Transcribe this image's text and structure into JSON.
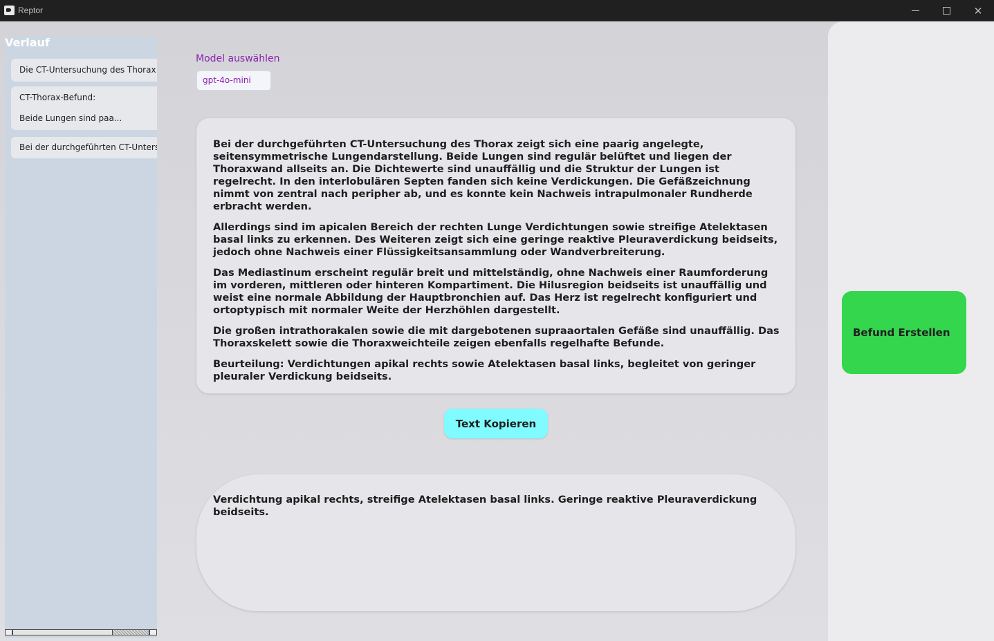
{
  "window": {
    "title": "Reptor",
    "app_icon": "reptor-app-icon",
    "controls": [
      "minimize-icon",
      "maximize-icon",
      "close-icon"
    ],
    "close_glyph": "✕"
  },
  "sidebar": {
    "title": "Verlauf",
    "items": [
      {
        "line1": "Die CT-Untersuchung des Thorax z",
        "line2": ""
      },
      {
        "line1": "CT-Thorax-Befund:",
        "line2": "Beide Lungen sind paa..."
      },
      {
        "line1": "Bei der durchgeführten CT-Untersu",
        "line2": ""
      }
    ]
  },
  "model": {
    "label": "Model auswählen",
    "selected": "gpt-4o-mini"
  },
  "report": {
    "paragraphs": [
      "Bei der durchgeführten CT-Untersuchung des Thorax zeigt sich eine paarig angelegte, seitensymmetrische Lungendarstellung. Beide Lungen sind regulär belüftet und liegen der Thoraxwand allseits an. Die Dichtewerte sind unauffällig und die Struktur der Lungen ist regelrecht. In den interlobulären Septen fanden sich keine Verdickungen. Die Gefäßzeichnung nimmt von zentral nach peripher ab, und es konnte kein Nachweis intrapulmonaler Rundherde erbracht werden.",
      "Allerdings sind im apicalen Bereich der rechten Lunge Verdichtungen sowie streifige Atelektasen basal links zu erkennen. Des Weiteren zeigt sich eine geringe reaktive Pleuraverdickung beidseits, jedoch ohne Nachweis einer Flüssigkeitsansammlung oder Wandverbreiterung.",
      "Das Mediastinum erscheint regulär breit und mittelständig, ohne Nachweis einer Raumforderung im vorderen, mittleren oder hinteren Kompartiment. Die Hilusregion beidseits ist unauffällig und weist eine normale Abbildung der Hauptbronchien auf. Das Herz ist regelrecht konfiguriert und ortoptypisch mit normaler Weite der Herzhöhlen dargestellt.",
      "Die großen intrathorakalen sowie die mit dargebotenen supraaortalen Gefäße sind unauffällig. Das Thoraxskelett sowie die Thoraxweichteile zeigen ebenfalls regelhafte Befunde.",
      "Beurteilung: Verdichtungen apikal rechts sowie Atelektasen basal links, begleitet von geringer pleuraler Verdickung beidseits."
    ]
  },
  "copy_button": {
    "label": "Text Kopieren"
  },
  "summary": {
    "text": "Verdichtung apikal rechts, streifige Atelektasen basal links. Geringe reaktive Pleuraverdickung beidseits."
  },
  "action_button": {
    "label": "Befund Erstellen"
  },
  "colors": {
    "accent_purple": "#8a1fb0",
    "copy_button": "#80fbff",
    "action_button": "#33d64d",
    "sidebar_bg": "#ccd6e2"
  }
}
